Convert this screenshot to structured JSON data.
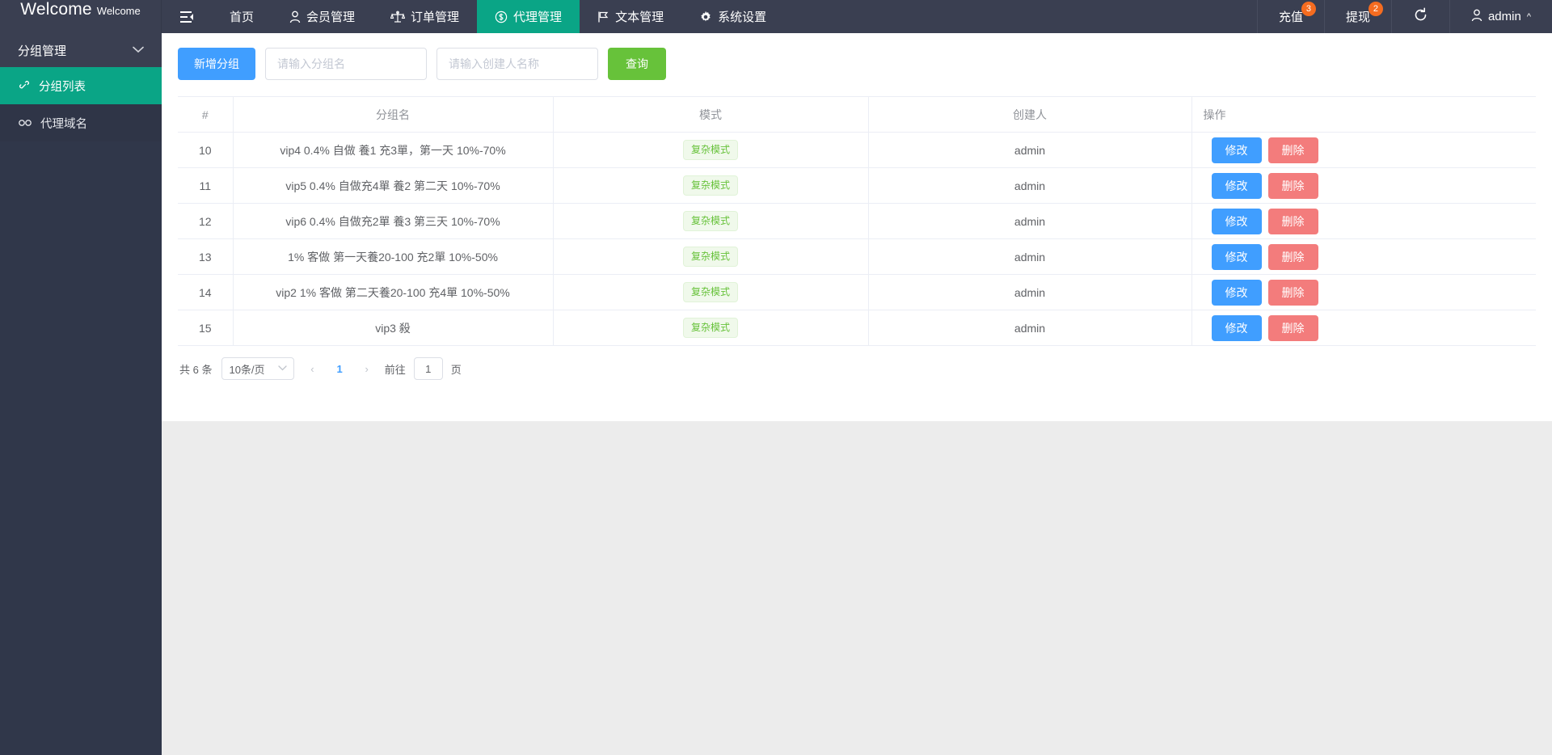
{
  "brand": {
    "main": "Welcome",
    "sub": "Welcome"
  },
  "topnav": {
    "collapse_icon": "menu-fold-icon",
    "items": [
      {
        "label": "首页",
        "icon": null,
        "active": false
      },
      {
        "label": "会员管理",
        "icon": "user-icon",
        "active": false
      },
      {
        "label": "订单管理",
        "icon": "scale-icon",
        "active": false
      },
      {
        "label": "代理管理",
        "icon": "dollar-circle-icon",
        "active": true
      },
      {
        "label": "文本管理",
        "icon": "flag-icon",
        "active": false
      },
      {
        "label": "系统设置",
        "icon": "gear-icon",
        "active": false
      }
    ],
    "right": [
      {
        "label": "充值",
        "badge": "3"
      },
      {
        "label": "提现",
        "badge": "2"
      },
      {
        "label": "",
        "icon": "refresh-icon"
      }
    ],
    "user": {
      "label": "admin",
      "icon": "user-icon",
      "caret": "chevron-up-icon"
    }
  },
  "sidebar": {
    "group_label": "分组管理",
    "group_chevron": "chevron-down-icon",
    "items": [
      {
        "label": "分组列表",
        "icon": "link-icon",
        "active": true
      },
      {
        "label": "代理域名",
        "icon": "infinity-icon",
        "active": false
      }
    ]
  },
  "toolbar": {
    "add_label": "新增分组",
    "group_name_placeholder": "请输入分组名",
    "group_name_value": "",
    "creator_placeholder": "请输入创建人名称",
    "creator_value": "",
    "query_label": "查询"
  },
  "table": {
    "headers": [
      "#",
      "分组名",
      "模式",
      "创建人",
      "操作"
    ],
    "rows": [
      {
        "id": "10",
        "name": "vip4 0.4% 自做 養1 充3單，第一天 10%-70%",
        "mode": "复杂模式",
        "creator": "admin",
        "edit": "修改",
        "del": "删除"
      },
      {
        "id": "11",
        "name": "vip5 0.4% 自做充4單 養2 第二天 10%-70%",
        "mode": "复杂模式",
        "creator": "admin",
        "edit": "修改",
        "del": "删除"
      },
      {
        "id": "12",
        "name": "vip6 0.4% 自做充2單 養3 第三天 10%-70%",
        "mode": "复杂模式",
        "creator": "admin",
        "edit": "修改",
        "del": "删除"
      },
      {
        "id": "13",
        "name": "1% 客做 第一天養20-100 充2單 10%-50%",
        "mode": "复杂模式",
        "creator": "admin",
        "edit": "修改",
        "del": "删除"
      },
      {
        "id": "14",
        "name": "vip2 1% 客做 第二天養20-100 充4單 10%-50%",
        "mode": "复杂模式",
        "creator": "admin",
        "edit": "修改",
        "del": "删除"
      },
      {
        "id": "15",
        "name": "vip3 殺",
        "mode": "复杂模式",
        "creator": "admin",
        "edit": "修改",
        "del": "删除"
      }
    ]
  },
  "pagination": {
    "total_label": "共 6 条",
    "page_size_label": "10条/页",
    "prev_icon": "‹",
    "next_icon": "›",
    "current_page": "1",
    "jump_label": "前往",
    "jump_value": "1",
    "jump_unit": "页"
  },
  "colors": {
    "accent": "#0aa586",
    "nav_bg": "#3a3f51",
    "sidebar_bg": "#30374a",
    "primary": "#409eff",
    "success": "#67c23a",
    "danger": "#f37c7c",
    "badge": "#f56c20"
  }
}
